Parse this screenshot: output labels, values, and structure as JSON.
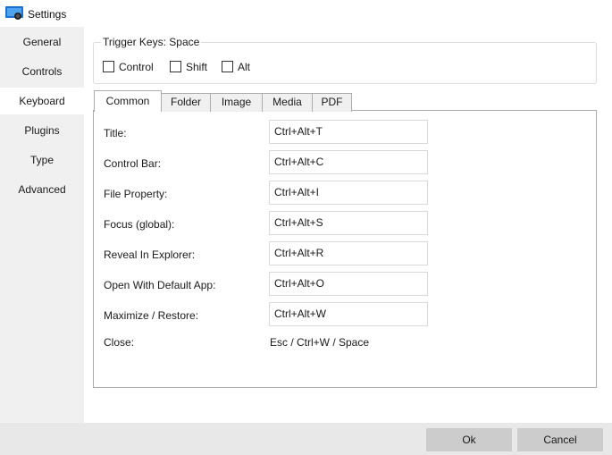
{
  "window": {
    "title": "Settings",
    "icon": "app-icon"
  },
  "sidebar": {
    "items": [
      {
        "label": "General",
        "active": false
      },
      {
        "label": "Controls",
        "active": false
      },
      {
        "label": "Keyboard",
        "active": true
      },
      {
        "label": "Plugins",
        "active": false
      },
      {
        "label": "Type",
        "active": false
      },
      {
        "label": "Advanced",
        "active": false
      }
    ]
  },
  "trigger": {
    "label": "Trigger Keys:",
    "value": "Space",
    "options": [
      {
        "label": "Control",
        "checked": false
      },
      {
        "label": "Shift",
        "checked": false
      },
      {
        "label": "Alt",
        "checked": false
      }
    ]
  },
  "tabs": [
    {
      "label": "Common",
      "active": true
    },
    {
      "label": "Folder",
      "active": false
    },
    {
      "label": "Image",
      "active": false
    },
    {
      "label": "Media",
      "active": false
    },
    {
      "label": "PDF",
      "active": false
    }
  ],
  "shortcuts": [
    {
      "label": "Title:",
      "value": "Ctrl+Alt+T"
    },
    {
      "label": "Control Bar:",
      "value": "Ctrl+Alt+C"
    },
    {
      "label": "File Property:",
      "value": "Ctrl+Alt+I"
    },
    {
      "label": "Focus (global):",
      "value": "Ctrl+Alt+S"
    },
    {
      "label": "Reveal In Explorer:",
      "value": "Ctrl+Alt+R"
    },
    {
      "label": "Open With Default App:",
      "value": "Ctrl+Alt+O"
    },
    {
      "label": "Maximize / Restore:",
      "value": "Ctrl+Alt+W"
    }
  ],
  "close": {
    "label": "Close:",
    "value": "Esc / Ctrl+W / Space"
  },
  "buttons": {
    "ok": "Ok",
    "cancel": "Cancel"
  },
  "colors": {
    "sidebar_bg": "#f0f0f0",
    "footer_bg": "#e8e8e8",
    "button_bg": "#cccccc",
    "icon_blue": "#1a6fd1"
  }
}
